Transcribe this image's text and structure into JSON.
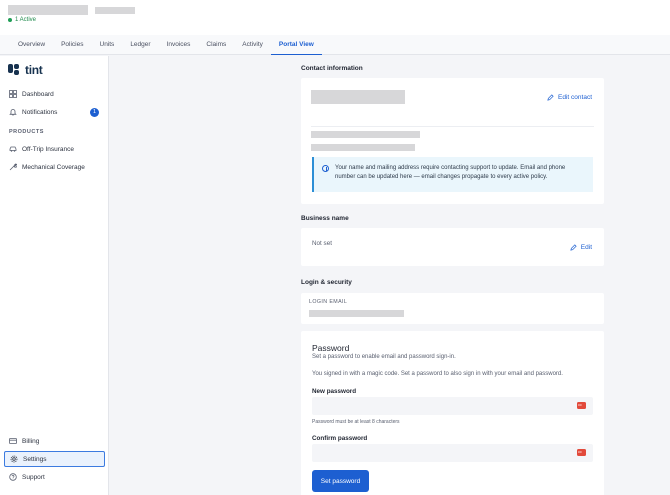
{
  "header": {
    "status_text": "1 Active",
    "status_color": "#1f9d55"
  },
  "tabs": [
    {
      "label": "Overview"
    },
    {
      "label": "Policies"
    },
    {
      "label": "Units"
    },
    {
      "label": "Ledger"
    },
    {
      "label": "Invoices"
    },
    {
      "label": "Claims"
    },
    {
      "label": "Activity"
    },
    {
      "label": "Portal View",
      "active": true
    }
  ],
  "sidebar": {
    "logo_text": "tint",
    "items": [
      {
        "label": "Dashboard",
        "icon": "grid-icon"
      },
      {
        "label": "Notifications",
        "icon": "bell-icon",
        "badge": "1"
      },
      {
        "label": "Off-Trip Insurance",
        "icon": "car-icon"
      },
      {
        "label": "Mechanical Coverage",
        "icon": "wrench-icon"
      }
    ],
    "section_label": "PRODUCTS",
    "bottom_items": [
      {
        "label": "Billing",
        "icon": "card-icon"
      },
      {
        "label": "Settings",
        "icon": "gear-icon",
        "selected": true
      },
      {
        "label": "Support",
        "icon": "help-icon"
      }
    ]
  },
  "contact": {
    "title": "Contact information",
    "edit_label": "Edit contact",
    "info_text": "Your name and mailing address require contacting support to update. Email and phone number can be updated here — email changes propagate to every active policy."
  },
  "business": {
    "title": "Business name",
    "value": "Not set",
    "edit_label": "Edit"
  },
  "login": {
    "title": "Login & security",
    "email_label": "LOGIN EMAIL"
  },
  "password": {
    "title": "Password",
    "subtitle": "Set a password to enable email and password sign-in.",
    "note": "You signed in with a magic code. Set a password to also sign in with your email and password.",
    "new_label": "New password",
    "hint": "Password must be at least 8 characters",
    "confirm_label": "Confirm password",
    "button_label": "Set password"
  },
  "colors": {
    "accent": "#1d5fd1",
    "key_icon": "#e24a3b"
  }
}
